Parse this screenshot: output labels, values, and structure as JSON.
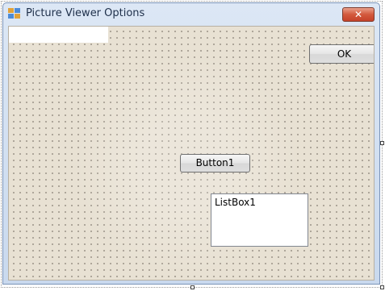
{
  "window": {
    "title": "Picture Viewer Options",
    "close_label": "✕"
  },
  "buttons": {
    "ok_label": "OK",
    "button1_label": "Button1"
  },
  "listbox": {
    "label": "ListBox1"
  },
  "colors": {
    "form_background": "#e8e1d3",
    "titlebar": "#c9d9ee",
    "close_button": "#d3593d"
  }
}
